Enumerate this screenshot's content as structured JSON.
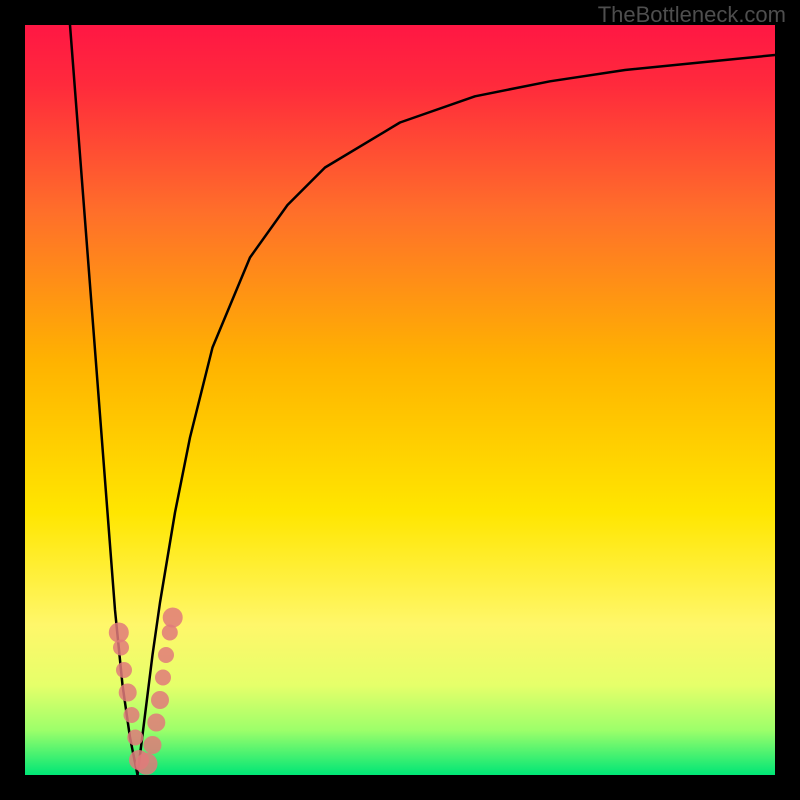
{
  "watermark": "TheBottleneck.com",
  "chart_data": {
    "type": "line",
    "title": "",
    "xlabel": "",
    "ylabel": "",
    "xlim": [
      0,
      100
    ],
    "ylim": [
      0,
      100
    ],
    "grid": false,
    "legend": false,
    "background_gradient": {
      "stops": [
        {
          "offset": 0,
          "color": "#ff1744"
        },
        {
          "offset": 8,
          "color": "#ff2a3c"
        },
        {
          "offset": 25,
          "color": "#ff6f2a"
        },
        {
          "offset": 45,
          "color": "#ffb300"
        },
        {
          "offset": 65,
          "color": "#ffe600"
        },
        {
          "offset": 80,
          "color": "#fff76a"
        },
        {
          "offset": 88,
          "color": "#e6ff6a"
        },
        {
          "offset": 94,
          "color": "#9dff6a"
        },
        {
          "offset": 100,
          "color": "#00e676"
        }
      ]
    },
    "series": [
      {
        "name": "left-descent",
        "type": "line",
        "x": [
          6,
          7,
          8,
          9,
          10,
          11,
          12,
          13,
          14,
          15
        ],
        "y": [
          100,
          87,
          74,
          61,
          48,
          35,
          22,
          12,
          5,
          0
        ]
      },
      {
        "name": "right-log-rise",
        "type": "line",
        "x": [
          15,
          16,
          17,
          18,
          20,
          22,
          25,
          30,
          35,
          40,
          50,
          60,
          70,
          80,
          90,
          100
        ],
        "y": [
          0,
          8,
          16,
          23,
          35,
          45,
          57,
          69,
          76,
          81,
          87,
          90.5,
          92.5,
          94,
          95,
          96
        ]
      }
    ],
    "markers": {
      "name": "cluster-points",
      "color": "#e07a7a",
      "points": [
        {
          "x": 12.5,
          "y": 19,
          "r": 10
        },
        {
          "x": 12.8,
          "y": 17,
          "r": 8
        },
        {
          "x": 13.2,
          "y": 14,
          "r": 8
        },
        {
          "x": 13.7,
          "y": 11,
          "r": 9
        },
        {
          "x": 14.2,
          "y": 8,
          "r": 8
        },
        {
          "x": 14.7,
          "y": 5,
          "r": 8
        },
        {
          "x": 15.2,
          "y": 2,
          "r": 10
        },
        {
          "x": 16.2,
          "y": 1.5,
          "r": 11
        },
        {
          "x": 17.0,
          "y": 4,
          "r": 9
        },
        {
          "x": 17.5,
          "y": 7,
          "r": 9
        },
        {
          "x": 18.0,
          "y": 10,
          "r": 9
        },
        {
          "x": 18.4,
          "y": 13,
          "r": 8
        },
        {
          "x": 18.8,
          "y": 16,
          "r": 8
        },
        {
          "x": 19.3,
          "y": 19,
          "r": 8
        },
        {
          "x": 19.7,
          "y": 21,
          "r": 10
        }
      ]
    }
  }
}
